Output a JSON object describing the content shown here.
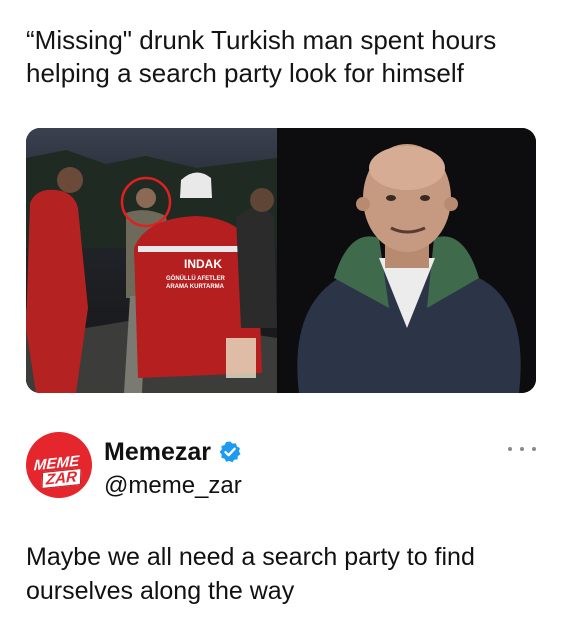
{
  "headline": "“Missing\" drunk Turkish man spent hours helping a search party look for himself",
  "photo": {
    "left_description_icon": "rescue-team-photo",
    "right_description_icon": "man-portrait-photo",
    "jacket_text_main": "INDAK",
    "jacket_text_sub": "GÖNÜLLÜ AFETLER",
    "jacket_text_sub2": "ARAMA KURTARMA"
  },
  "account": {
    "name": "Memezar",
    "handle": "@meme_zar",
    "avatar_word1": "MEME",
    "avatar_word2": "ZAR",
    "verified_color": "#1d9bf0",
    "brand_color": "#e5262d"
  },
  "tweet": {
    "text": "Maybe we all need a search party to find ourselves along the way"
  }
}
